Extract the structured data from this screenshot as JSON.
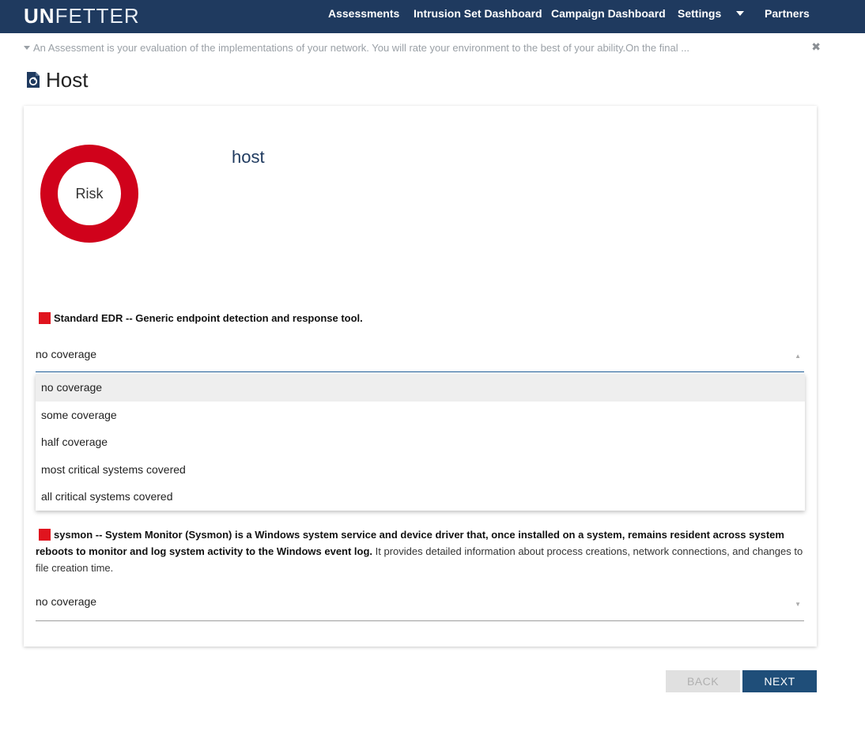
{
  "app": {
    "logo_bold": "UN",
    "logo_rest": "FETTER"
  },
  "nav": {
    "items": [
      "Assessments",
      "Intrusion Set Dashboard",
      "Campaign Dashboard",
      "Settings",
      "Partners"
    ]
  },
  "banner": {
    "text": "An Assessment is your evaluation of the implementations of your network. You will rate your environment to the best of your ability.On the final ...",
    "close_icon": "✖"
  },
  "page": {
    "title": "Host"
  },
  "card": {
    "risk_label": "Risk",
    "heading": "host",
    "risk_color": "#d0021b"
  },
  "questions": [
    {
      "name_bold": "Standard EDR -- Generic endpoint detection and response tool.",
      "desc": "",
      "value": "no coverage",
      "status_color": "#e0141e"
    },
    {
      "name_bold": "sysmon -- System Monitor (Sysmon) is a Windows system service and device driver that, once installed on a system, remains resident across system reboots to monitor and log system activity to the Windows event log.",
      "desc": " It provides detailed information about process creations, network connections, and changes to file creation time.",
      "value": "no coverage",
      "status_color": "#e0141e"
    }
  ],
  "dropdown": {
    "options": [
      "no coverage",
      "some coverage",
      "half coverage",
      "most critical systems covered",
      "all critical systems covered"
    ],
    "selected": "no coverage"
  },
  "buttons": {
    "back": "BACK",
    "next": "NEXT"
  },
  "colors": {
    "navbar": "#1f3a5f",
    "accent": "#1f4e79",
    "status_red": "#e0141e"
  }
}
